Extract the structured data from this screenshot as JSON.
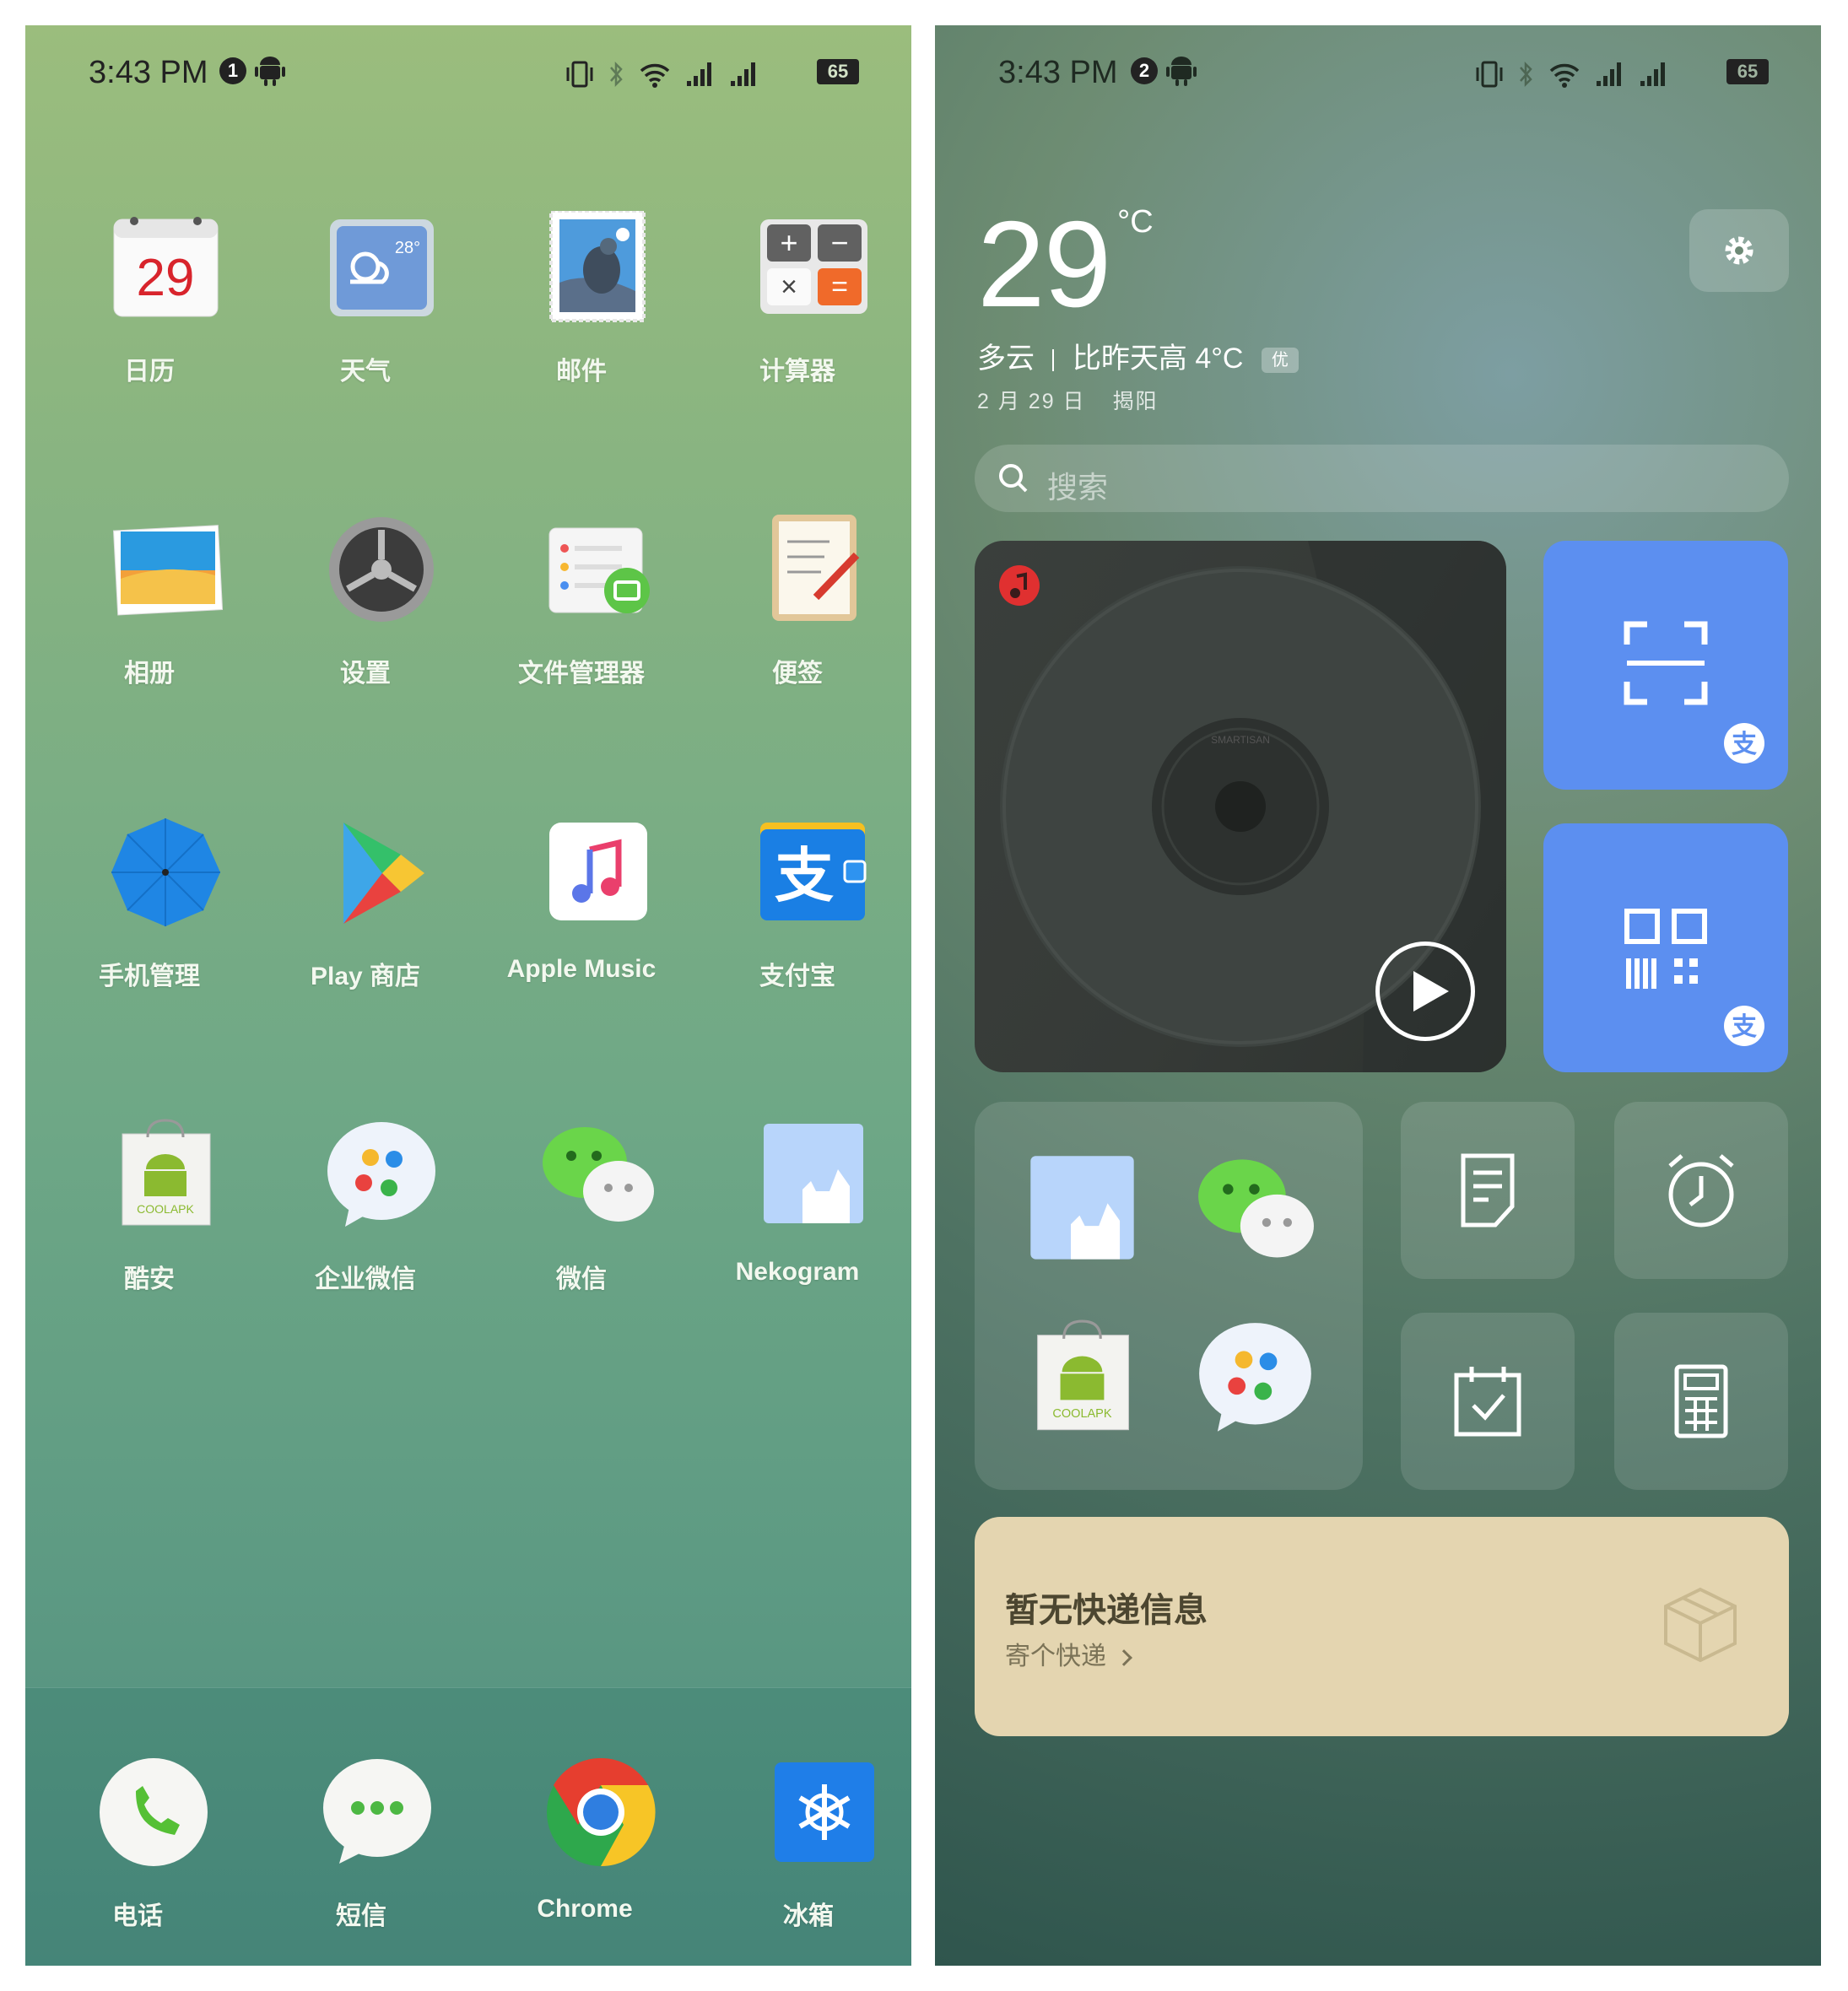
{
  "left_screen": {
    "status": {
      "time": "3:43 PM",
      "notif_count": "1",
      "battery": "65"
    },
    "apps": [
      {
        "label": "日历",
        "icon": "calendar-icon",
        "icon_text": "29"
      },
      {
        "label": "天气",
        "icon": "weather-icon",
        "icon_text": "28°"
      },
      {
        "label": "邮件",
        "icon": "mail-icon"
      },
      {
        "label": "计算器",
        "icon": "calculator-icon"
      },
      {
        "label": "相册",
        "icon": "gallery-icon"
      },
      {
        "label": "设置",
        "icon": "settings-gear-icon"
      },
      {
        "label": "文件管理器",
        "icon": "file-manager-icon"
      },
      {
        "label": "便签",
        "icon": "notes-icon"
      },
      {
        "label": "手机管理",
        "icon": "umbrella-icon"
      },
      {
        "label": "Play 商店",
        "icon": "play-store-icon"
      },
      {
        "label": "Apple Music",
        "icon": "music-note-icon"
      },
      {
        "label": "支付宝",
        "icon": "alipay-icon",
        "icon_text": "支"
      },
      {
        "label": "酷安",
        "icon": "coolapk-icon",
        "icon_text": "COOLAPK"
      },
      {
        "label": "企业微信",
        "icon": "wecom-icon"
      },
      {
        "label": "微信",
        "icon": "wechat-icon"
      },
      {
        "label": "Nekogram",
        "icon": "nekogram-icon"
      }
    ],
    "dock": [
      {
        "label": "电话",
        "icon": "phone-icon"
      },
      {
        "label": "短信",
        "icon": "messages-icon"
      },
      {
        "label": "Chrome",
        "icon": "chrome-icon"
      },
      {
        "label": "冰箱",
        "icon": "icebox-icon"
      }
    ]
  },
  "right_screen": {
    "status": {
      "time": "3:43 PM",
      "notif_count": "2",
      "battery": "65"
    },
    "weather": {
      "temp": "29",
      "unit": "°C",
      "condition": "多云",
      "compare": "比昨天高 4°C",
      "aqi": "优",
      "date": "2 月 29 日",
      "city": "揭阳"
    },
    "search": {
      "placeholder": "搜索"
    },
    "music": {
      "brand_text": "SMARTISAN"
    },
    "express": {
      "title": "暂无快递信息",
      "link": "寄个快递"
    },
    "colors": {
      "alipay_blue": "#5c8ff0",
      "express_bg": "#e4d5b0"
    }
  }
}
